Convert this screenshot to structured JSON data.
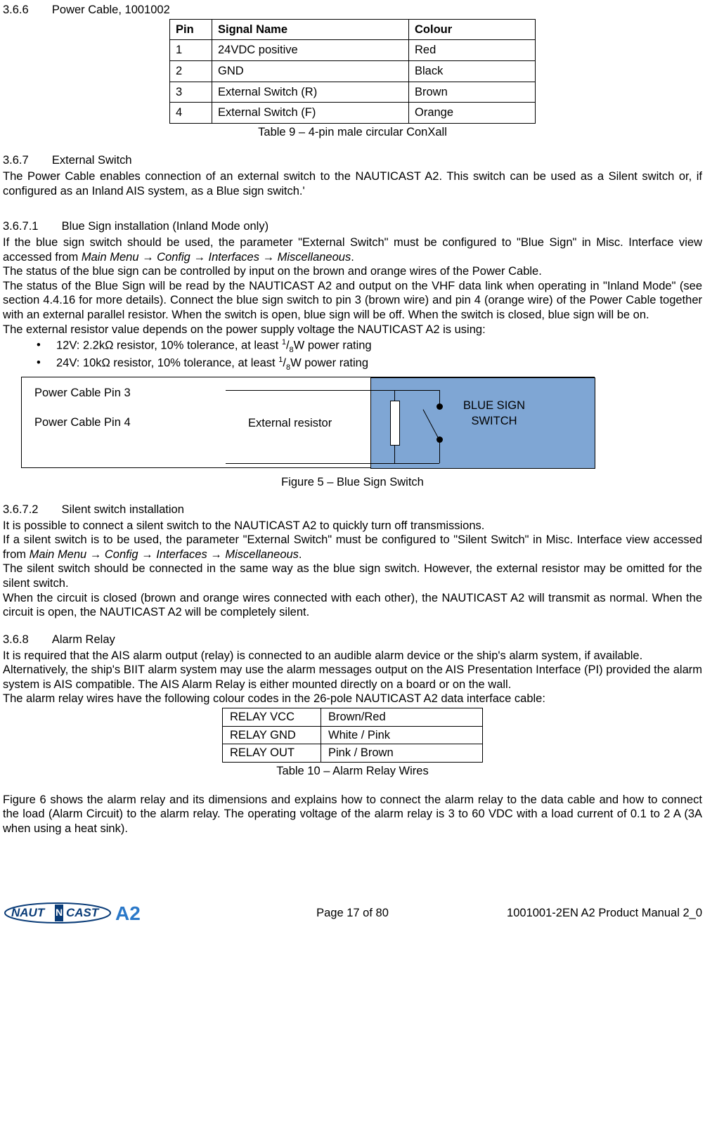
{
  "section366": {
    "num": "3.6.6",
    "title": "Power Cable, 1001002"
  },
  "pinTable": {
    "headers": {
      "pin": "Pin",
      "signal": "Signal Name",
      "colour": "Colour"
    },
    "rows": [
      {
        "pin": "1",
        "signal": "24VDC positive",
        "colour": "Red"
      },
      {
        "pin": "2",
        "signal": "GND",
        "colour": "Black"
      },
      {
        "pin": "3",
        "signal": "External Switch (R)",
        "colour": "Brown"
      },
      {
        "pin": "4",
        "signal": "External Switch (F)",
        "colour": "Orange"
      }
    ],
    "caption": "Table 9 – 4-pin male circular ConXall"
  },
  "section367": {
    "num": "3.6.7",
    "title": "External Switch"
  },
  "p367": "The Power Cable enables connection of an external switch to the NAUTICAST A2. This switch can be used as a Silent switch or, if configured as an Inland AIS system, as a Blue sign switch.'",
  "section3671": {
    "num": "3.6.7.1",
    "title": "Blue Sign installation (Inland Mode only)"
  },
  "p3671a_pre": "If the blue sign switch should be used, the parameter \"External Switch\" must be configured to \"Blue Sign\" in Misc. Interface view accessed from ",
  "nav1": "Main Menu → Config → Interfaces → Miscellaneous",
  "period": ".",
  "p3671b": "The status of the blue sign can be controlled by input on the brown and orange wires of the Power Cable.",
  "p3671c": "The status of the Blue Sign will be read by the NAUTICAST A2 and output on the VHF data link when operating in \"Inland Mode\" (see section 4.4.16 for more details). Connect the blue sign switch to pin 3 (brown wire) and pin 4 (orange wire) of the Power Cable together with an external parallel resistor. When the switch is open, blue sign will be off. When the switch is closed, blue sign will be on.",
  "p3671d": "The external resistor value depends on the power supply voltage the NAUTICAST A2 is using:",
  "bullets": {
    "b1_a": "12V: 2.2kΩ resistor, 10% tolerance, at least ",
    "b1_b": "W power rating",
    "b2_a": "24V: 10kΩ resistor, 10% tolerance, at least ",
    "b2_b": "W power rating",
    "frac_num": "1",
    "frac_den": "8"
  },
  "diagram": {
    "pin3": "Power Cable Pin 3",
    "pin4": "Power Cable Pin 4",
    "resistor": "External resistor",
    "blue1": "BLUE SIGN",
    "blue2": "SWITCH"
  },
  "fig5": "Figure 5 – Blue Sign Switch",
  "section3672": {
    "num": "3.6.7.2",
    "title": "Silent switch installation"
  },
  "p3672a": "It is possible to connect a silent switch to the NAUTICAST A2 to quickly turn off transmissions.",
  "p3672b_pre": "If a silent switch is to be used, the parameter \"External Switch\" must be configured to \"Silent Switch\" in Misc. Interface view accessed from ",
  "p3672c": "The silent switch should be connected in the same way as the blue sign switch. However, the external resistor may be omitted for the silent switch.",
  "p3672d": "When the circuit is closed (brown and orange wires connected with each other), the NAUTICAST A2 will transmit as normal. When the circuit is open, the NAUTICAST A2 will be completely silent.",
  "section368": {
    "num": "3.6.8",
    "title": "Alarm Relay"
  },
  "p368a": "It is required that the AIS alarm output (relay) is connected to an audible alarm device or the ship's alarm system, if available.",
  "p368b": "Alternatively, the ship's BIIT alarm system may use the alarm messages output on the AIS Presentation Interface (PI) provided the alarm system is AIS compatible. The AIS Alarm Relay is either mounted directly on a board or on the wall.",
  "p368c": "The alarm relay wires have the following colour codes in the 26-pole NAUTICAST A2 data interface cable:",
  "relayTable": {
    "rows": [
      {
        "a": "RELAY VCC",
        "b": "Brown/Red"
      },
      {
        "a": "RELAY GND",
        "b": "White / Pink"
      },
      {
        "a": "RELAY OUT",
        "b": "Pink / Brown"
      }
    ],
    "caption": "Table 10 – Alarm Relay Wires"
  },
  "p368d": "Figure 6 shows the alarm relay and its dimensions and explains how to connect the alarm relay to the data cable and how to connect the load (Alarm Circuit) to the alarm relay. The operating voltage of the alarm relay is 3 to 60 VDC with a load current of 0.1 to 2 A (3A when using a heat sink).",
  "footer": {
    "page": "Page 17 of 80",
    "doc": "1001001-2EN A2 Product Manual 2_0"
  }
}
